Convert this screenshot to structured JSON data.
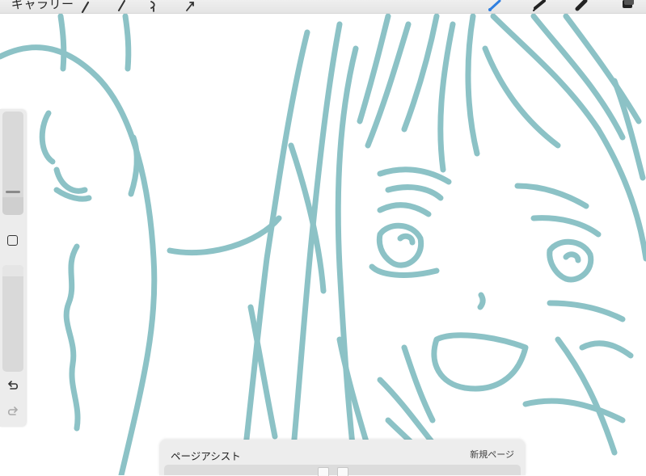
{
  "app": {
    "gallery_label": "ギャラリー"
  },
  "toolbar": {
    "left_icons": [
      "wrench-icon",
      "magic-wand-icon",
      "selection-icon",
      "transform-arrow-icon"
    ],
    "right_icons": [
      "brush-icon",
      "smudge-icon",
      "eraser-icon",
      "layers-icon"
    ],
    "active_tool": "brush-icon",
    "active_color": "#2f7fe0"
  },
  "sidebar": {
    "brush_size_level": 0.2,
    "opacity_level": 0.9,
    "icons": [
      "modify-square-icon",
      "undo-icon",
      "redo-icon"
    ]
  },
  "page_assist": {
    "title": "ページアシスト",
    "new_page_label": "新規ページ"
  },
  "canvas": {
    "stroke_color": "#8cc2c6",
    "background": "#ffffff"
  }
}
